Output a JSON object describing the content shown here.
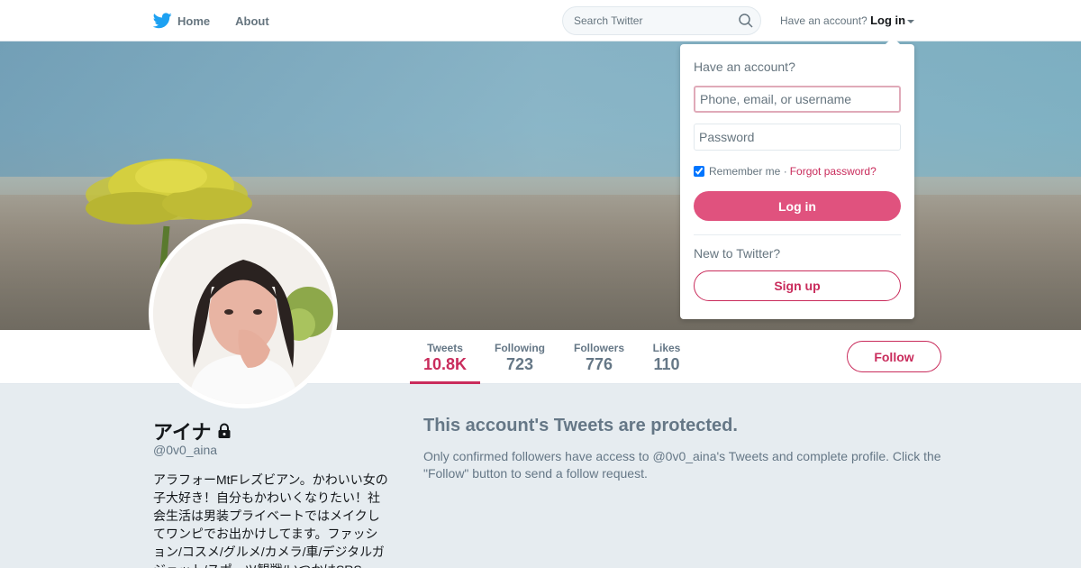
{
  "nav": {
    "home_label": "Home",
    "about_label": "About",
    "search_placeholder": "Search Twitter",
    "have_account_text": "Have an account?",
    "login_label": "Log in"
  },
  "profile": {
    "name": "アイナ",
    "handle": "@0v0_aina",
    "bio": "アラフォーMtFレズビアン。かわいい女の子大好き！自分もかわいくなりたい！社会生活は男装プライベートではメイクしてワンピでお出かけしてます。ファッション/コスメ/グルメ/カメラ/車/デジタルガジェット/スポーツ観戦/いつかはSRS"
  },
  "stats": [
    {
      "label": "Tweets",
      "value": "10.8K"
    },
    {
      "label": "Following",
      "value": "723"
    },
    {
      "label": "Followers",
      "value": "776"
    },
    {
      "label": "Likes",
      "value": "110"
    }
  ],
  "follow_label": "Follow",
  "protected": {
    "title": "This account's Tweets are protected.",
    "text": "Only confirmed followers have access to @0v0_aina's Tweets and complete profile. Click the \"Follow\" button to send a follow request."
  },
  "login_dropdown": {
    "heading": "Have an account?",
    "username_placeholder": "Phone, email, or username",
    "password_placeholder": "Password",
    "remember_label": "Remember me",
    "separator": "·",
    "forgot_label": "Forgot password?",
    "login_button": "Log in",
    "new_to_label": "New to Twitter?",
    "signup_button": "Sign up"
  },
  "colors": {
    "accent": "#c92c5c",
    "login_button_bg": "#e0527e",
    "twitter_blue": "#1da1f2",
    "muted_text": "#657786",
    "background": "#e6ecf0"
  },
  "icons": [
    "twitter-bird-icon",
    "search-icon",
    "lock-icon",
    "caret-down-icon"
  ]
}
